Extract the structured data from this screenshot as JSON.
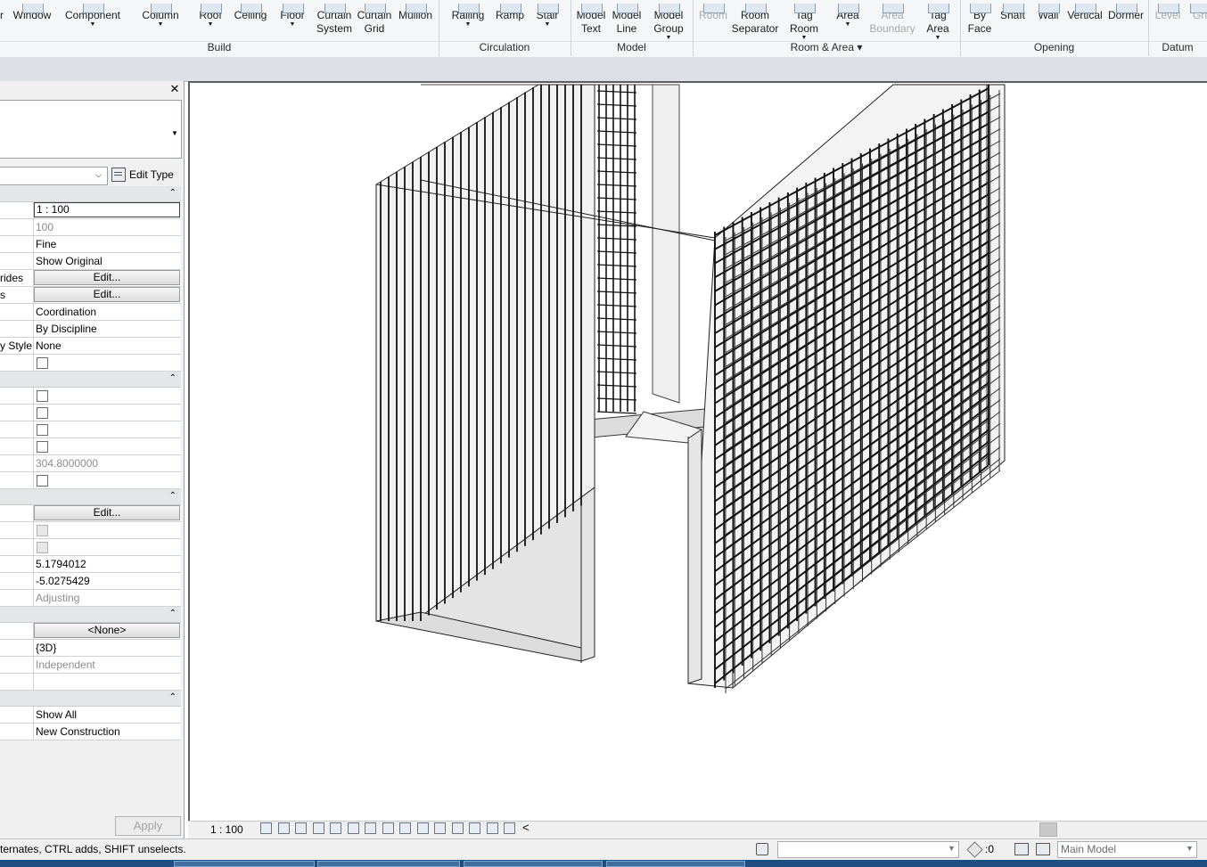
{
  "ribbon": {
    "buttons": [
      {
        "id": "window",
        "label": "Window",
        "dropdown": false,
        "disabled": false
      },
      {
        "id": "component",
        "label": "Component",
        "dropdown": true,
        "disabled": false
      },
      {
        "id": "column",
        "label": "Column",
        "dropdown": true,
        "disabled": false
      },
      {
        "id": "roof",
        "label": "Roof",
        "dropdown": true,
        "disabled": false
      },
      {
        "id": "ceiling",
        "label": "Ceiling",
        "dropdown": false,
        "disabled": false
      },
      {
        "id": "floor",
        "label": "Floor",
        "dropdown": true,
        "disabled": false
      },
      {
        "id": "curtain-system",
        "label": "Curtain\nSystem",
        "dropdown": false,
        "disabled": false
      },
      {
        "id": "curtain-grid",
        "label": "Curtain\nGrid",
        "dropdown": false,
        "disabled": false
      },
      {
        "id": "mullion",
        "label": "Mullion",
        "dropdown": false,
        "disabled": false
      },
      {
        "id": "railing",
        "label": "Railing",
        "dropdown": true,
        "disabled": false
      },
      {
        "id": "ramp",
        "label": "Ramp",
        "dropdown": false,
        "disabled": false
      },
      {
        "id": "stair",
        "label": "Stair",
        "dropdown": true,
        "disabled": false
      },
      {
        "id": "model-text",
        "label": "Model\nText",
        "dropdown": false,
        "disabled": false
      },
      {
        "id": "model-line",
        "label": "Model\nLine",
        "dropdown": false,
        "disabled": false
      },
      {
        "id": "model-group",
        "label": "Model\nGroup",
        "dropdown": true,
        "disabled": false
      },
      {
        "id": "room",
        "label": "Room",
        "dropdown": false,
        "disabled": true
      },
      {
        "id": "room-separator",
        "label": "Room\nSeparator",
        "dropdown": false,
        "disabled": false
      },
      {
        "id": "tag-room",
        "label": "Tag\nRoom",
        "dropdown": true,
        "disabled": false
      },
      {
        "id": "area",
        "label": "Area",
        "dropdown": true,
        "disabled": false
      },
      {
        "id": "area-boundary",
        "label": "Area\nBoundary",
        "dropdown": false,
        "disabled": true
      },
      {
        "id": "tag-area",
        "label": "Tag\nArea",
        "dropdown": true,
        "disabled": false
      },
      {
        "id": "by-face",
        "label": "By\nFace",
        "dropdown": false,
        "disabled": false
      },
      {
        "id": "shaft",
        "label": "Shaft",
        "dropdown": false,
        "disabled": false
      },
      {
        "id": "wall-opening",
        "label": "Wall",
        "dropdown": false,
        "disabled": false
      },
      {
        "id": "vertical",
        "label": "Vertical",
        "dropdown": false,
        "disabled": false
      },
      {
        "id": "dormer",
        "label": "Dormer",
        "dropdown": false,
        "disabled": false
      },
      {
        "id": "level",
        "label": "Level",
        "dropdown": false,
        "disabled": true
      },
      {
        "id": "grid",
        "label": "Gri",
        "dropdown": false,
        "disabled": true
      }
    ],
    "panels": [
      {
        "id": "build",
        "label": "Build"
      },
      {
        "id": "circulation",
        "label": "Circulation"
      },
      {
        "id": "model",
        "label": "Model"
      },
      {
        "id": "room-area",
        "label": "Room & Area ▾"
      },
      {
        "id": "opening",
        "label": "Opening"
      },
      {
        "id": "datum",
        "label": "Datum"
      }
    ],
    "partial_first_label": "r"
  },
  "properties": {
    "close_glyph": "✕",
    "edit_type_label": "Edit Type",
    "apply_label": "Apply",
    "rows": [
      {
        "kind": "header"
      },
      {
        "kind": "prop",
        "name": "",
        "value": "1 : 100",
        "style": "input"
      },
      {
        "kind": "prop",
        "name": "",
        "value": "100",
        "style": "gray"
      },
      {
        "kind": "prop",
        "name": "",
        "value": "Fine",
        "style": "text"
      },
      {
        "kind": "prop",
        "name": "",
        "value": "Show Original",
        "style": "text"
      },
      {
        "kind": "prop",
        "name": "rides",
        "value": "Edit...",
        "style": "button"
      },
      {
        "kind": "prop",
        "name": "s",
        "value": "Edit...",
        "style": "button"
      },
      {
        "kind": "prop",
        "name": "",
        "value": "Coordination",
        "style": "text"
      },
      {
        "kind": "prop",
        "name": "",
        "value": "By Discipline",
        "style": "text"
      },
      {
        "kind": "prop",
        "name": "y Style",
        "value": "None",
        "style": "text"
      },
      {
        "kind": "prop",
        "name": "",
        "value": "",
        "style": "checkbox"
      },
      {
        "kind": "header"
      },
      {
        "kind": "prop",
        "name": "",
        "value": "",
        "style": "checkbox"
      },
      {
        "kind": "prop",
        "name": "",
        "value": "",
        "style": "checkbox"
      },
      {
        "kind": "prop",
        "name": "",
        "value": "",
        "style": "checkbox"
      },
      {
        "kind": "prop",
        "name": "",
        "value": "",
        "style": "checkbox"
      },
      {
        "kind": "prop",
        "name": "",
        "value": "304.8000000",
        "style": "gray"
      },
      {
        "kind": "prop",
        "name": "",
        "value": "",
        "style": "checkbox"
      },
      {
        "kind": "header"
      },
      {
        "kind": "prop",
        "name": "",
        "value": "Edit...",
        "style": "button"
      },
      {
        "kind": "prop",
        "name": "",
        "value": "",
        "style": "checkbox-disabled"
      },
      {
        "kind": "prop",
        "name": "",
        "value": "",
        "style": "checkbox-disabled"
      },
      {
        "kind": "prop",
        "name": "",
        "value": "5.1794012",
        "style": "text"
      },
      {
        "kind": "prop",
        "name": "",
        "value": "-5.0275429",
        "style": "text"
      },
      {
        "kind": "prop",
        "name": "",
        "value": "Adjusting",
        "style": "gray"
      },
      {
        "kind": "header"
      },
      {
        "kind": "prop",
        "name": "",
        "value": "<None>",
        "style": "button"
      },
      {
        "kind": "prop",
        "name": "",
        "value": "{3D}",
        "style": "text"
      },
      {
        "kind": "prop",
        "name": "",
        "value": "Independent",
        "style": "gray"
      },
      {
        "kind": "prop",
        "name": "",
        "value": "",
        "style": "text"
      },
      {
        "kind": "header"
      },
      {
        "kind": "prop",
        "name": "",
        "value": "Show All",
        "style": "text"
      },
      {
        "kind": "prop",
        "name": "",
        "value": "New Construction",
        "style": "text"
      }
    ]
  },
  "view_bar": {
    "scale": "1 : 100",
    "collapse_glyph": "<",
    "icons": [
      "detail-level-icon",
      "visual-style-icon",
      "sun-path-icon",
      "shadows-icon",
      "render-icon",
      "crop-view-icon",
      "show-crop-icon",
      "unlock-3d-icon",
      "temporary-hide-icon",
      "reveal-hidden-icon",
      "temporary-view-properties-icon",
      "show-analytical-model-icon",
      "highlight-displacement-icon",
      "worksharing-display-icon",
      "constraints-icon"
    ]
  },
  "status_bar": {
    "text": "ternates, CTRL adds, SHIFT unselects.",
    "selection_count": ":0",
    "model_dropdown": "Main Model"
  }
}
